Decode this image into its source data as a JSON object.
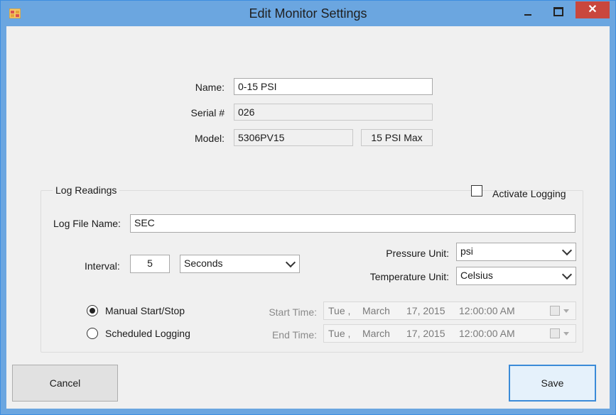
{
  "window": {
    "title": "Edit Monitor Settings",
    "close_glyph": "✕"
  },
  "icons": {
    "app": "app-icon",
    "minimize": "minimize-icon",
    "maximize": "maximize-icon",
    "close": "close-icon"
  },
  "monitor": {
    "name_label": "Name:",
    "name_value": "0-15 PSI",
    "serial_label": "Serial #",
    "serial_value": "026",
    "model_label": "Model:",
    "model_value": "5306PV15",
    "model_max": "15 PSI Max"
  },
  "log": {
    "group_title": "Log Readings",
    "activate_label": "Activate Logging",
    "activate_checked": false,
    "file_name_label": "Log File Name:",
    "file_name_value": "SEC",
    "interval_label": "Interval:",
    "interval_value": "5",
    "interval_unit": "Seconds",
    "pressure_label": "Pressure Unit:",
    "pressure_value": "psi",
    "temperature_label": "Temperature Unit:",
    "temperature_value": "Celsius",
    "manual_label": "Manual Start/Stop",
    "scheduled_label": "Scheduled Logging",
    "selected_mode": "manual",
    "start_label": "Start Time:",
    "end_label": "End Time:",
    "start": {
      "day": "Tue ,",
      "month": "March",
      "date": "17, 2015",
      "time": "12:00:00 AM"
    },
    "end": {
      "day": "Tue ,",
      "month": "March",
      "date": "17, 2015",
      "time": "12:00:00 AM"
    }
  },
  "buttons": {
    "cancel": "Cancel",
    "save": "Save"
  },
  "colors": {
    "titlebar": "#6ba6e0",
    "close": "#c9473d",
    "client": "#f0f0f0",
    "accent": "#3b8bd8"
  }
}
